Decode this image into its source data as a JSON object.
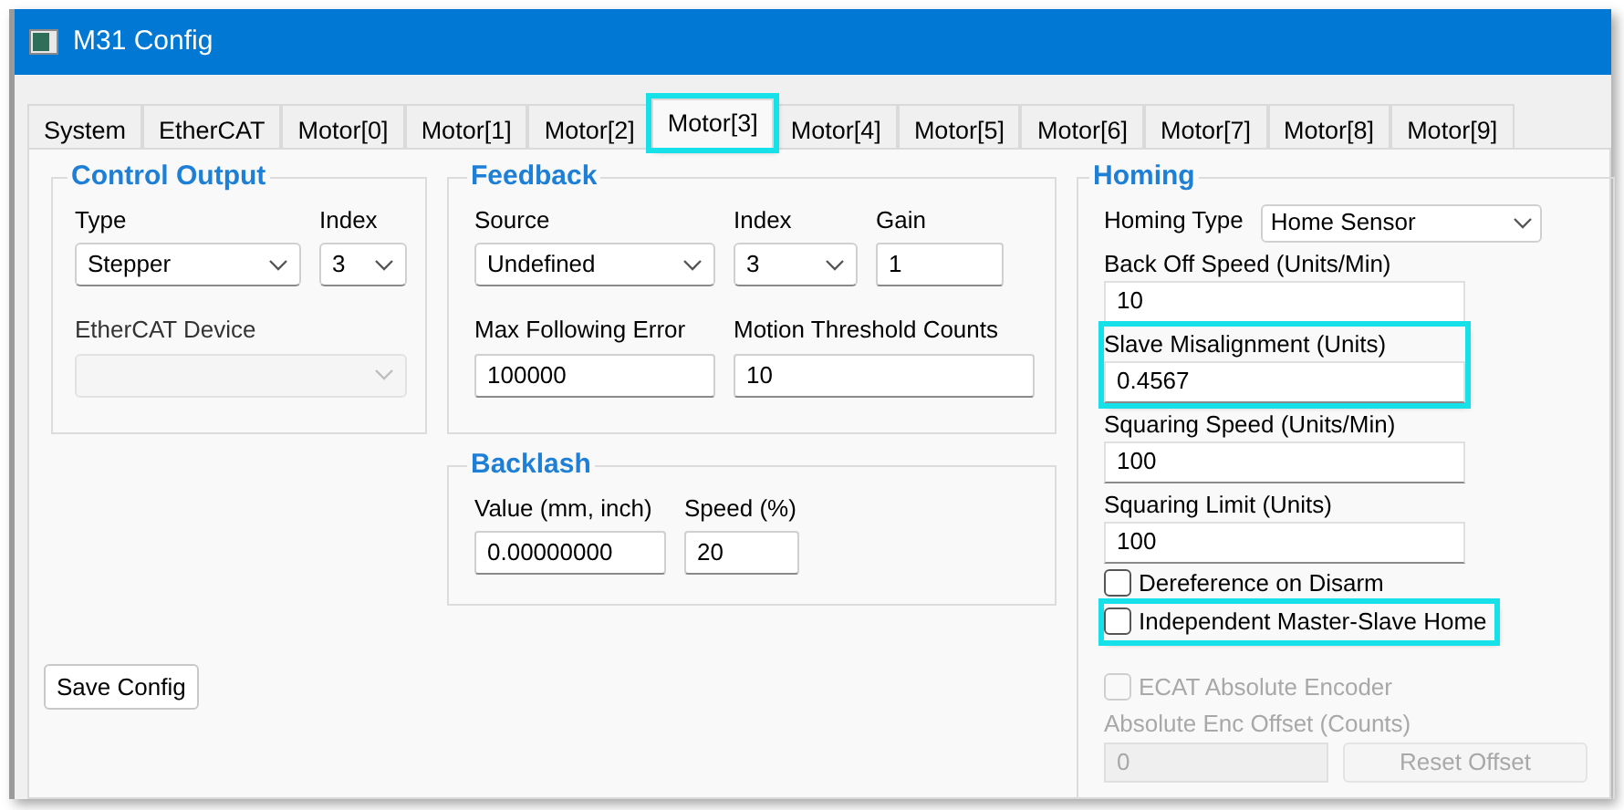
{
  "window": {
    "title": "M31 Config"
  },
  "tabs": [
    {
      "label": "System",
      "selected": false,
      "highlighted": false
    },
    {
      "label": "EtherCAT",
      "selected": false,
      "highlighted": false
    },
    {
      "label": "Motor[0]",
      "selected": false,
      "highlighted": false
    },
    {
      "label": "Motor[1]",
      "selected": false,
      "highlighted": false
    },
    {
      "label": "Motor[2]",
      "selected": false,
      "highlighted": false
    },
    {
      "label": "Motor[3]",
      "selected": true,
      "highlighted": true
    },
    {
      "label": "Motor[4]",
      "selected": false,
      "highlighted": false
    },
    {
      "label": "Motor[5]",
      "selected": false,
      "highlighted": false
    },
    {
      "label": "Motor[6]",
      "selected": false,
      "highlighted": false
    },
    {
      "label": "Motor[7]",
      "selected": false,
      "highlighted": false
    },
    {
      "label": "Motor[8]",
      "selected": false,
      "highlighted": false
    },
    {
      "label": "Motor[9]",
      "selected": false,
      "highlighted": false
    }
  ],
  "control_output": {
    "title": "Control Output",
    "rows": [
      [
        {
          "kind": "select",
          "label": "Type",
          "value": "Stepper",
          "disabled": false
        },
        {
          "kind": "select",
          "label": "Index",
          "value": "3",
          "disabled": false
        }
      ],
      [
        {
          "kind": "select",
          "label": "EtherCAT Device",
          "disabled": true
        }
      ]
    ]
  },
  "feedback": {
    "title": "Feedback",
    "rows": [
      [
        {
          "kind": "select",
          "label": "Source",
          "value": "Undefined",
          "disabled": false
        },
        {
          "kind": "select",
          "label": "Index",
          "value": "3",
          "disabled": false
        },
        {
          "kind": "input",
          "label": "Gain",
          "value": "1",
          "disabled": false
        }
      ],
      [
        {
          "kind": "input",
          "label": "Max Following Error",
          "value": "100000",
          "disabled": false
        },
        {
          "kind": "input",
          "label": "Motion Threshold Counts",
          "value": "10",
          "disabled": false
        }
      ]
    ]
  },
  "backlash": {
    "title": "Backlash",
    "rows": [
      [
        {
          "kind": "input",
          "label": "Value (mm, inch)",
          "value": "0.00000000",
          "disabled": false
        },
        {
          "kind": "input",
          "label": "Speed (%)",
          "value": "20",
          "disabled": false
        }
      ]
    ]
  },
  "save_button": "Save Config",
  "homing": {
    "title": "Homing",
    "homing_type": {
      "label": "Homing Type",
      "value": "Home Sensor"
    },
    "fields": [
      {
        "label": "Back Off Speed (Units/Min)",
        "value": "10",
        "highlighted": false
      },
      {
        "label": "Slave Misalignment (Units)",
        "value": "0.4567",
        "highlighted": true
      },
      {
        "label": "Squaring Speed (Units/Min)",
        "value": "100",
        "highlighted": false
      },
      {
        "label": "Squaring Limit (Units)",
        "value": "100",
        "highlighted": false
      }
    ],
    "checkboxes": [
      {
        "label": "Dereference on Disarm",
        "checked": false,
        "disabled": false,
        "highlighted": false
      },
      {
        "label": "Independent Master-Slave Home",
        "checked": false,
        "disabled": false,
        "highlighted": true
      }
    ],
    "ecat_checkbox": {
      "label": "ECAT Absolute Encoder",
      "checked": false,
      "disabled": true
    },
    "offset": {
      "label": "Absolute Enc Offset (Counts)",
      "value": "0",
      "disabled": true,
      "button": "Reset Offset"
    }
  }
}
